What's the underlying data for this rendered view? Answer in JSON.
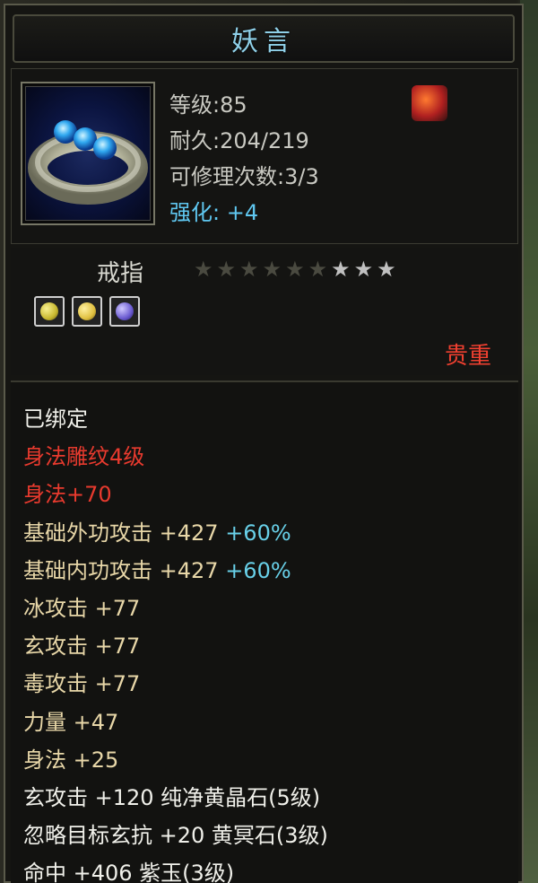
{
  "tooltip": {
    "title": "妖言",
    "item_icon": "ring-icon",
    "stats": {
      "level": "等级:85",
      "durability": "耐久:204/219",
      "repairs": "可修理次数:3/3",
      "enhance_label": "强化: ",
      "enhance_value": "+4"
    },
    "corner_icon": "flame-feather-icon",
    "item_type": "戒指",
    "stars": {
      "total": 9,
      "lit": 3
    },
    "gems": [
      {
        "icon": "yellow-gem-icon",
        "color": "#c8b830"
      },
      {
        "icon": "gold-gem-icon",
        "color": "#e0c040"
      },
      {
        "icon": "purple-gem-icon",
        "color": "#6a5ad0"
      }
    ],
    "quality": "贵重",
    "attributes": {
      "bound": "已绑定",
      "engrave": "身法雕纹4级",
      "engrave_bonus": "身法+70",
      "outer_attack": "基础外功攻击 +427",
      "outer_attack_pct": "+60%",
      "inner_attack": "基础内功攻击 +427",
      "inner_attack_pct": "+60%",
      "ice_attack": "冰攻击 +77",
      "xuan_attack": "玄攻击 +77",
      "poison_attack": "毒攻击 +77",
      "strength": "力量 +47",
      "agility": "身法 +25",
      "gem1": "玄攻击 +120 纯净黄晶石(5级)",
      "gem2": "忽略目标玄抗 +20 黄冥石(3级)",
      "gem3": "命中 +406 紫玉(3级)"
    }
  },
  "colors": {
    "title": "#8fd0e8",
    "enhance": "#5fc7f0",
    "quality": "#f04030",
    "engrave": "#e83a2e",
    "attr": "#e8d7a8"
  }
}
